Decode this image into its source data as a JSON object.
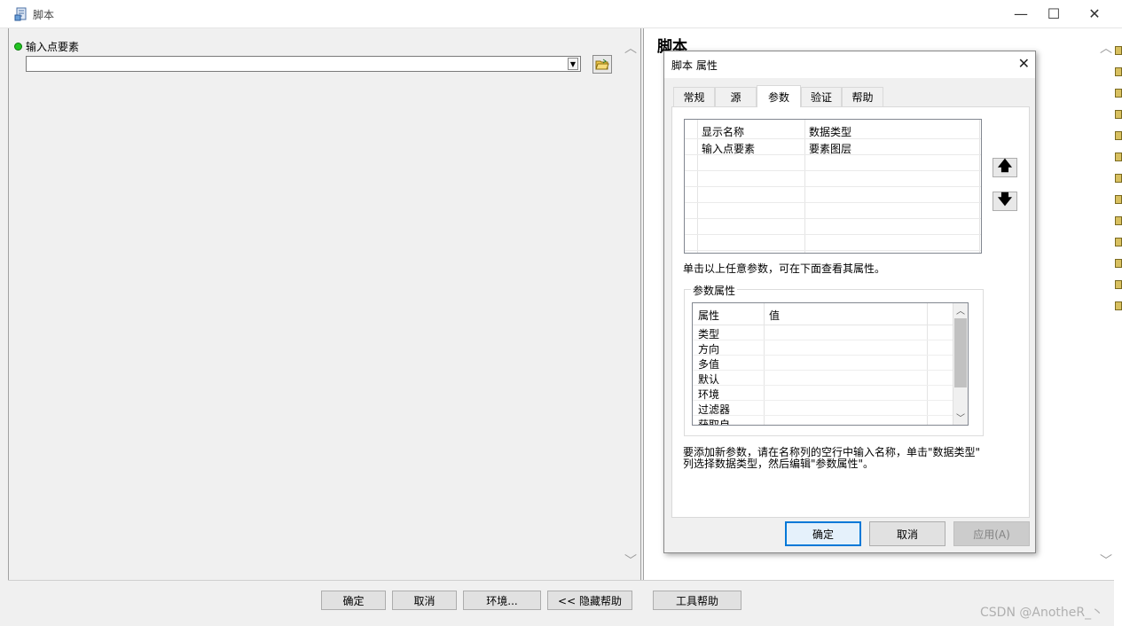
{
  "window": {
    "title": "脚本",
    "controls": {
      "minimize": "—",
      "maximize": "☐",
      "close": "✕"
    }
  },
  "tool": {
    "param_label": "输入点要素",
    "param_value": ""
  },
  "help": {
    "title": "脚本"
  },
  "bottom_buttons": {
    "ok": "确定",
    "cancel": "取消",
    "env": "环境...",
    "hide_help": "<< 隐藏帮助",
    "tool_help": "工具帮助"
  },
  "watermark": "CSDN @AnotheR_丶",
  "dialog": {
    "title": "脚本 属性",
    "tabs": [
      "常规",
      "源",
      "参数",
      "验证",
      "帮助"
    ],
    "active_tab": "参数",
    "param_table": {
      "headers": [
        "显示名称",
        "数据类型"
      ],
      "rows": [
        [
          "输入点要素",
          "要素图层"
        ]
      ]
    },
    "hint": "单击以上任意参数，可在下面查看其属性。",
    "props_group_label": "参数属性",
    "props_table": {
      "headers": [
        "属性",
        "值"
      ],
      "rows": [
        "类型",
        "方向",
        "多值",
        "默认",
        "环境",
        "过滤器",
        "获取自"
      ]
    },
    "footer_line1": "要添加新参数，请在名称列的空行中输入名称，单击\"数据类型\"",
    "footer_line2": "列选择数据类型，然后编辑\"参数属性\"。",
    "buttons": {
      "ok": "确定",
      "cancel": "取消",
      "apply": "应用(A)"
    }
  },
  "colors": {
    "status_dot": "#22c322",
    "focus_border": "#0078d7"
  }
}
